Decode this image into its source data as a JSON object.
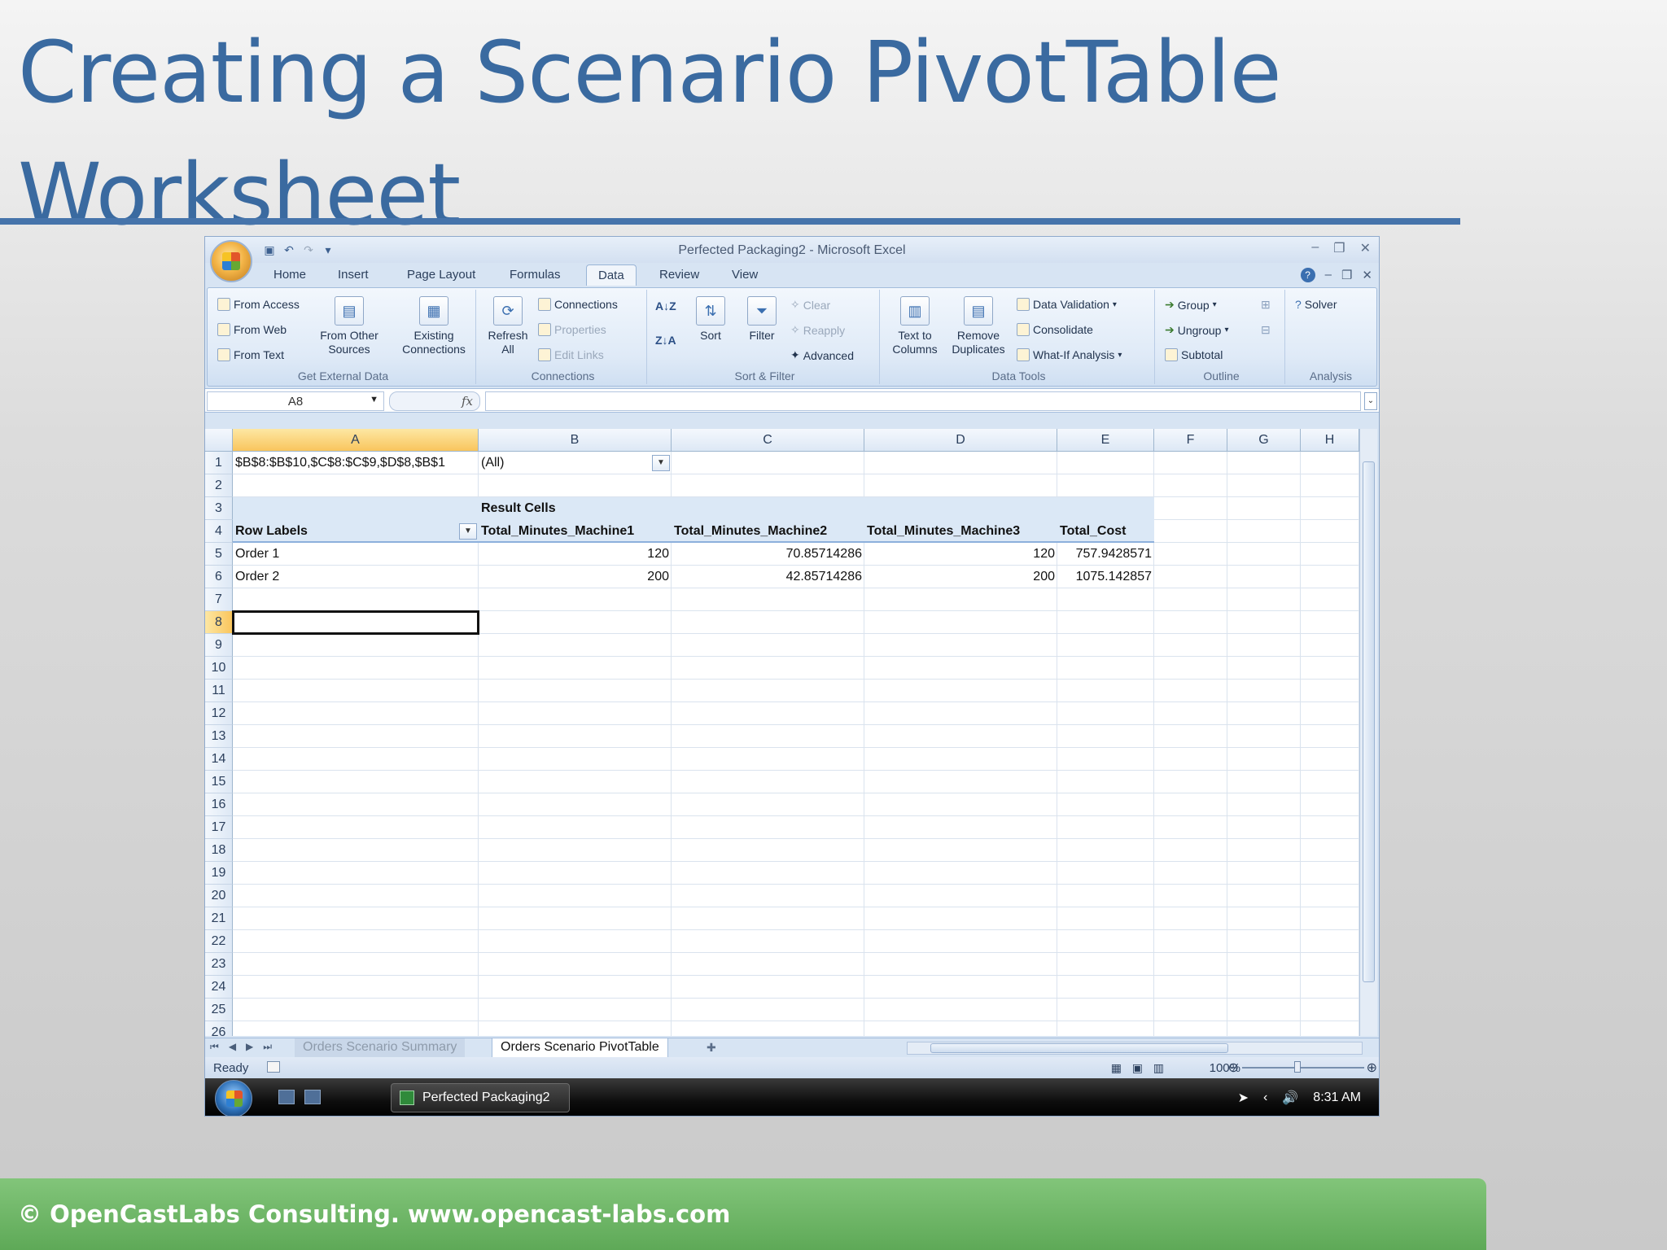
{
  "slide": {
    "title_line1": "Creating a Scenario PivotTable",
    "title_line2": "Worksheet",
    "footer": "© OpenCastLabs Consulting. www.opencast-labs.com"
  },
  "excel": {
    "window_title": "Perfected Packaging2 - Microsoft Excel",
    "tabs": [
      "Home",
      "Insert",
      "Page Layout",
      "Formulas",
      "Data",
      "Review",
      "View"
    ],
    "active_tab": "Data",
    "ribbon": {
      "get_external_data": {
        "label": "Get External Data",
        "from_access": "From Access",
        "from_web": "From Web",
        "from_text": "From Text",
        "from_other_sources_1": "From Other",
        "from_other_sources_2": "Sources",
        "existing_connections_1": "Existing",
        "existing_connections_2": "Connections"
      },
      "connections": {
        "label": "Connections",
        "refresh_all_1": "Refresh",
        "refresh_all_2": "All",
        "connections": "Connections",
        "properties": "Properties",
        "edit_links": "Edit Links"
      },
      "sort_filter": {
        "label": "Sort & Filter",
        "sort": "Sort",
        "filter": "Filter",
        "clear": "Clear",
        "reapply": "Reapply",
        "advanced": "Advanced"
      },
      "data_tools": {
        "label": "Data Tools",
        "text_to_columns_1": "Text to",
        "text_to_columns_2": "Columns",
        "remove_duplicates_1": "Remove",
        "remove_duplicates_2": "Duplicates",
        "data_validation": "Data Validation",
        "consolidate": "Consolidate",
        "what_if": "What-If Analysis"
      },
      "outline": {
        "label": "Outline",
        "group": "Group",
        "ungroup": "Ungroup",
        "subtotal": "Subtotal"
      },
      "analysis": {
        "label": "Analysis",
        "solver": "Solver"
      }
    },
    "name_box": "A8",
    "fx_symbol": "fx",
    "columns": [
      "A",
      "B",
      "C",
      "D",
      "E",
      "F",
      "G",
      "H"
    ],
    "rows": [
      "1",
      "2",
      "3",
      "4",
      "5",
      "6",
      "7",
      "8",
      "9",
      "10",
      "11",
      "12",
      "13",
      "14",
      "15",
      "16",
      "17",
      "18",
      "19",
      "20",
      "21",
      "22",
      "23",
      "24",
      "25",
      "26"
    ],
    "cells": {
      "a1": "$B$8:$B$10,$C$8:$C$9,$D$8,$B$1",
      "b1": "(All)",
      "b3": "Result Cells",
      "a4": "Row Labels",
      "b4": "Total_Minutes_Machine1",
      "c4": "Total_Minutes_Machine2",
      "d4": "Total_Minutes_Machine3",
      "e4": "Total_Cost",
      "a5": "Order 1",
      "b5": "120",
      "c5": "70.85714286",
      "d5": "120",
      "e5": "757.9428571",
      "a6": "Order 2",
      "b6": "200",
      "c6": "42.85714286",
      "d6": "200",
      "e6": "1075.142857"
    },
    "sheet_tabs": {
      "inactive": "Orders Scenario Summary",
      "active": "Orders Scenario PivotTable"
    },
    "status": "Ready",
    "zoom": "100%",
    "taskbar": {
      "task": "Perfected Packaging2",
      "clock": "8:31 AM"
    }
  }
}
